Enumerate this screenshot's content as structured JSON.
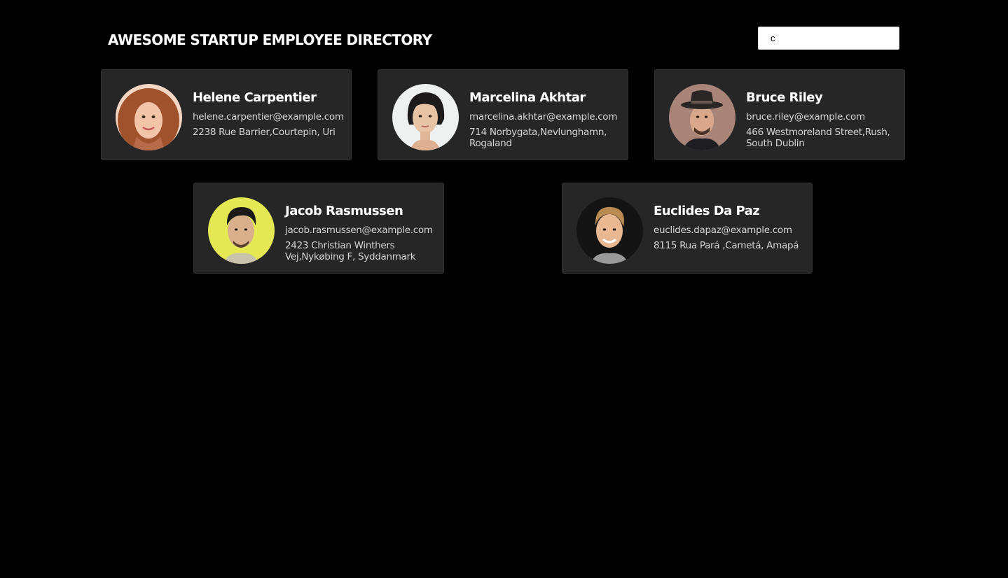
{
  "header": {
    "title": "AWESOME STARTUP EMPLOYEE DIRECTORY"
  },
  "search": {
    "value": "c",
    "placeholder": ""
  },
  "employees": [
    {
      "name": "Helene Carpentier",
      "email": "helene.carpentier@example.com",
      "address": "2238 Rue Barrier,Courtepin, Uri"
    },
    {
      "name": "Marcelina Akhtar",
      "email": "marcelina.akhtar@example.com",
      "address": "714 Norbygata,Nevlunghamn, Rogaland"
    },
    {
      "name": "Bruce Riley",
      "email": "bruce.riley@example.com",
      "address": "466 Westmoreland Street,Rush, South Dublin"
    },
    {
      "name": "Jacob Rasmussen",
      "email": "jacob.rasmussen@example.com",
      "address": "2423 Christian Winthers Vej,Nykøbing F, Syddanmark"
    },
    {
      "name": "Euclides Da Paz",
      "email": "euclides.dapaz@example.com",
      "address": "8115 Rua Pará ,Cametá, Amapá"
    }
  ],
  "colors": {
    "background": "#000000",
    "card": "#262626",
    "text": "#ffffff",
    "muted_text": "#d4d4d4"
  }
}
